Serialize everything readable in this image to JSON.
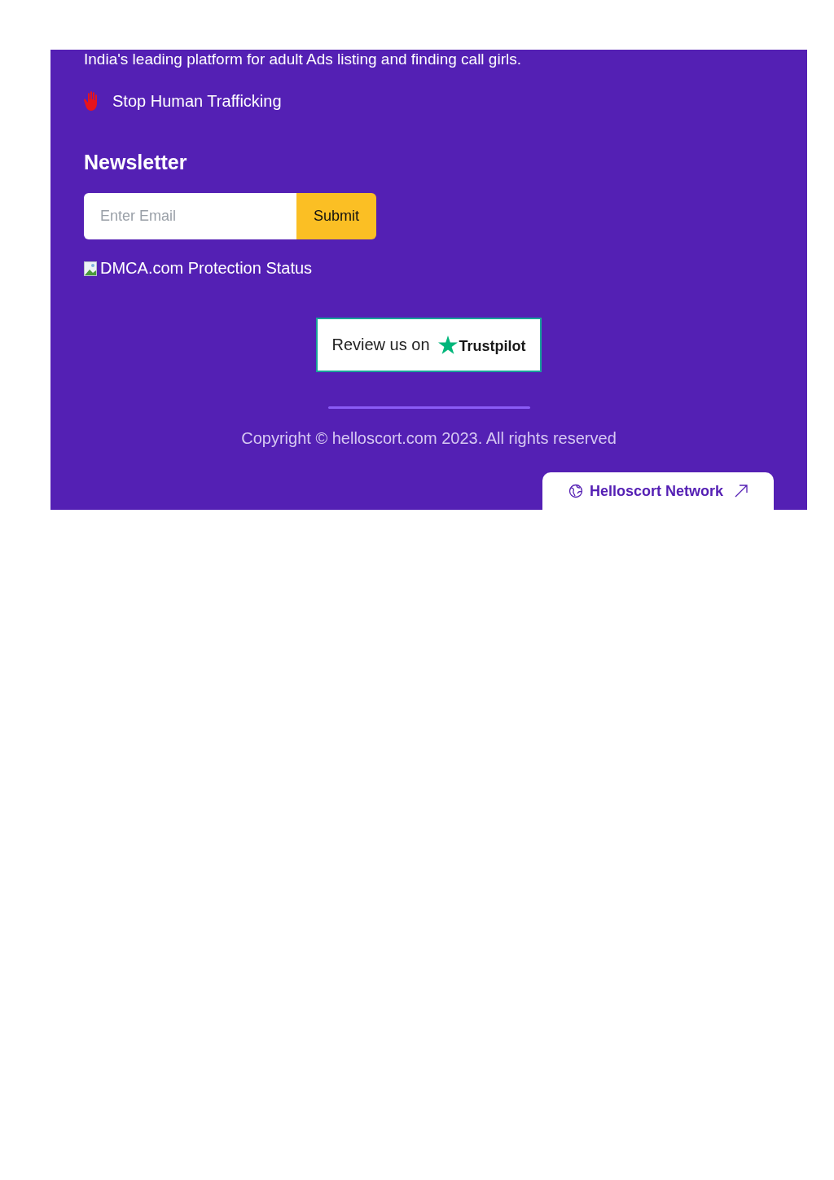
{
  "footer": {
    "tagline": "India's leading platform for adult Ads listing and finding call girls.",
    "notice": "Stop Human Trafficking",
    "newsletter": {
      "title": "Newsletter",
      "email_field": {
        "placeholder": "Enter Email"
      },
      "submit_button": "Submit"
    },
    "dmca_badge": "DMCA.com Protection Status",
    "review_button": {
      "text": "Review us on",
      "brand": "Trustpilot"
    },
    "copyright": "Copyright © helloscort.com 2023. All rights reserved",
    "network_tab": "Helloscort Network"
  }
}
